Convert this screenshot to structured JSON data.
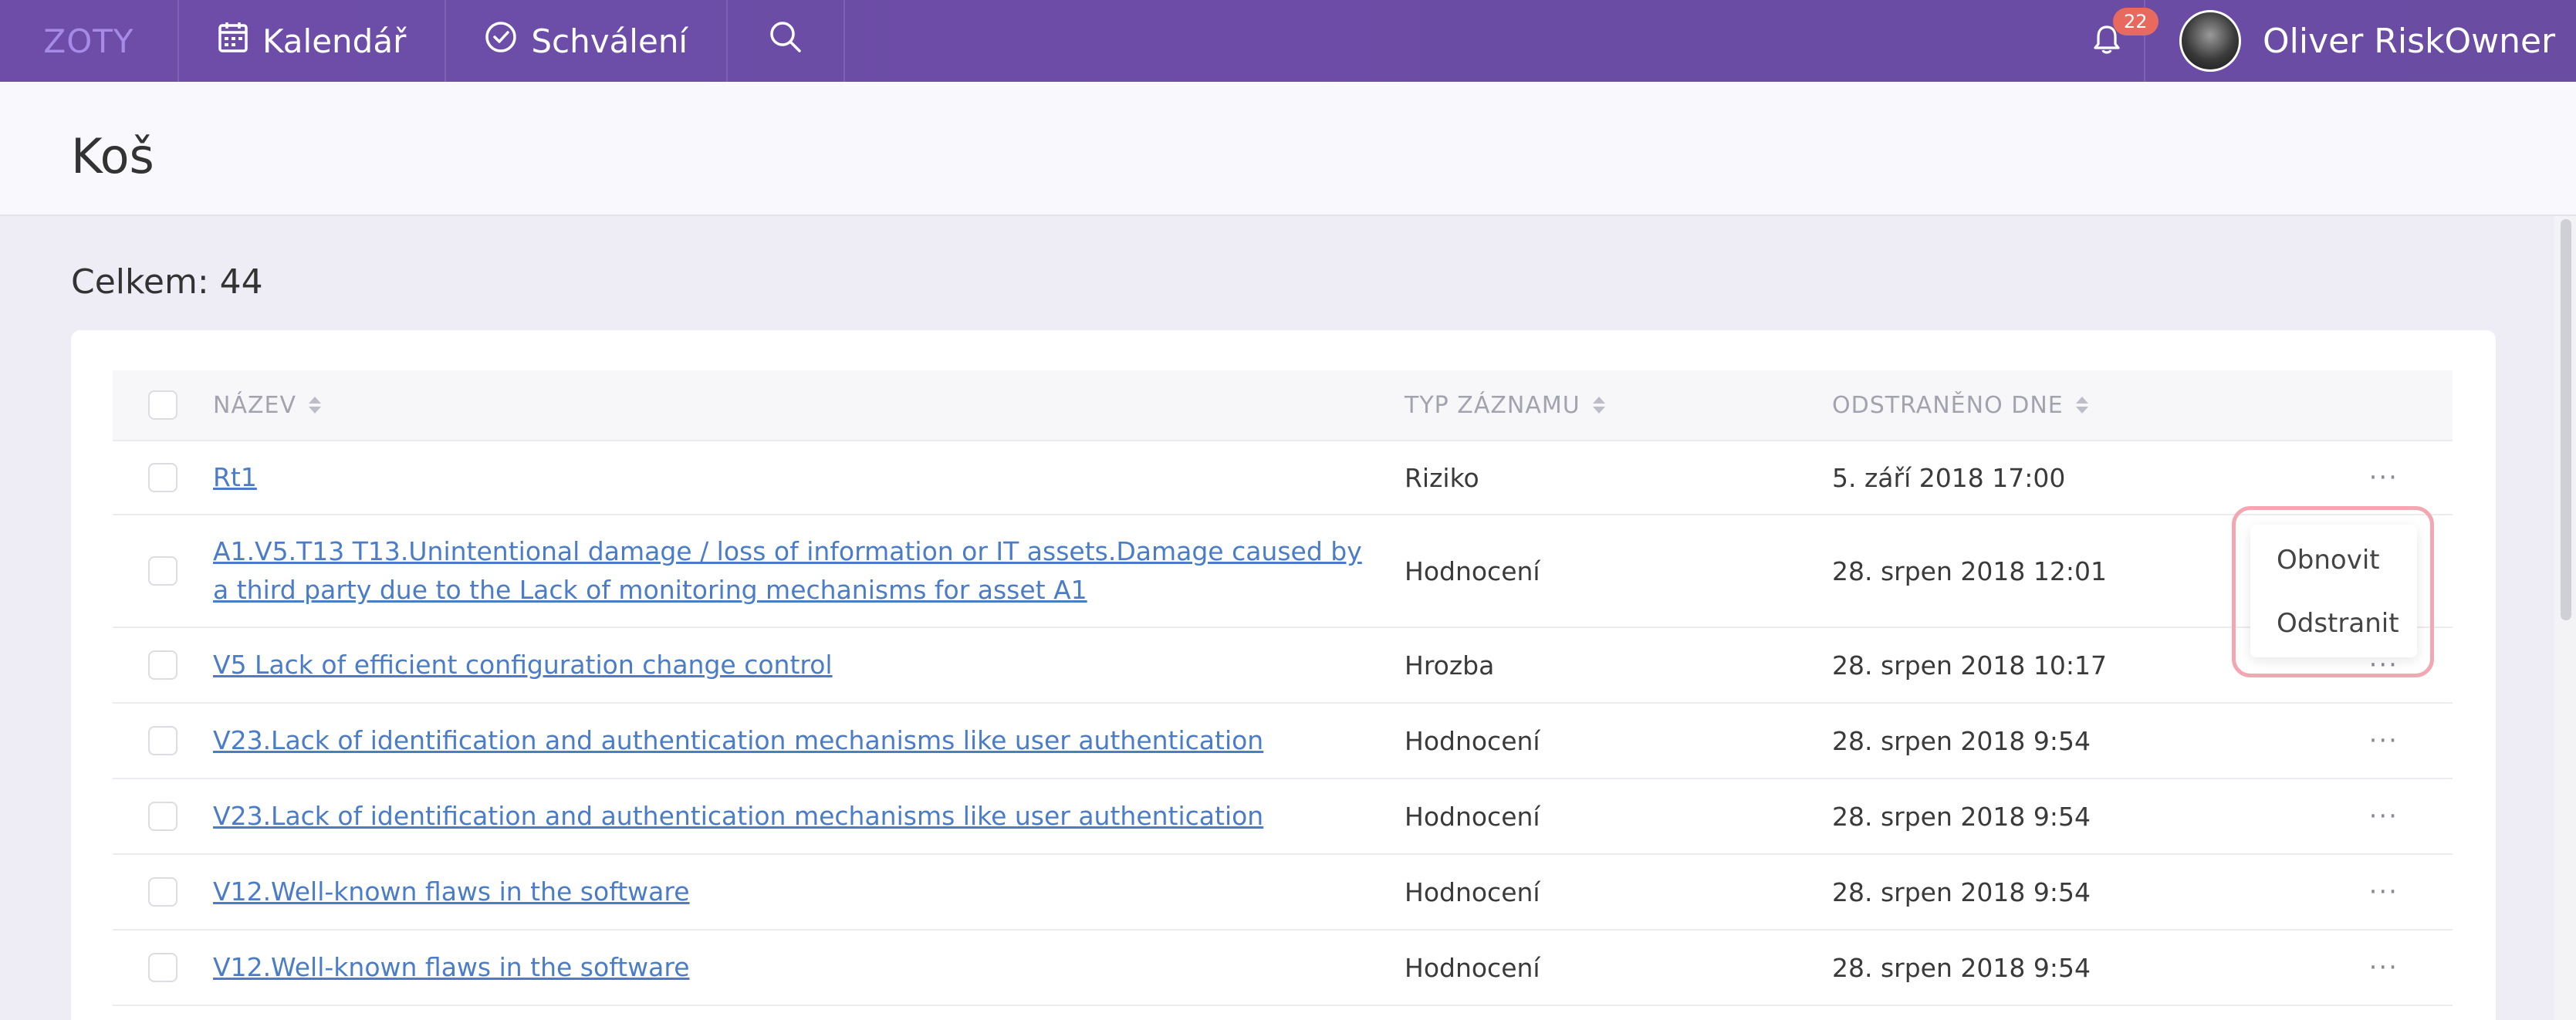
{
  "topbar": {
    "brand": "ZOTY",
    "nav": [
      {
        "label": "Kalendář",
        "icon": "calendar-icon"
      },
      {
        "label": "Schválení",
        "icon": "check-circle-icon"
      }
    ],
    "notifications_count": "22",
    "user_name": "Oliver RiskOwner",
    "colors": {
      "bar": "#6b4ca6",
      "badge": "#e86a5f"
    }
  },
  "page": {
    "title": "Koš",
    "total": "Celkem: 44"
  },
  "table": {
    "headers": {
      "name": "NÁZEV",
      "type": "TYP ZÁZNAMU",
      "deleted": "ODSTRANĚNO DNE"
    },
    "rows": [
      {
        "name": "Rt1",
        "type": "Riziko",
        "date": "5. září 2018 17:00"
      },
      {
        "name": "A1.V5.T13 T13.Unintentional damage / loss of information or IT assets.Damage caused by a third party due to the Lack of monitoring mechanisms for asset A1",
        "type": "Hodnocení",
        "date": "28. srpen 2018 12:01"
      },
      {
        "name": "V5 Lack of efficient configuration change control",
        "type": "Hrozba",
        "date": "28. srpen 2018 10:17"
      },
      {
        "name": "V23.Lack of identification and authentication mechanisms like user authentication",
        "type": "Hodnocení",
        "date": "28. srpen 2018 9:54"
      },
      {
        "name": "V23.Lack of identification and authentication mechanisms like user authentication",
        "type": "Hodnocení",
        "date": "28. srpen 2018 9:54"
      },
      {
        "name": "V12.Well-known flaws in the software",
        "type": "Hodnocení",
        "date": "28. srpen 2018 9:54"
      },
      {
        "name": "V12.Well-known flaws in the software",
        "type": "Hodnocení",
        "date": "28. srpen 2018 9:54"
      }
    ],
    "actions_label": "···"
  },
  "context_menu": {
    "restore": "Obnovit",
    "delete": "Odstranit"
  }
}
